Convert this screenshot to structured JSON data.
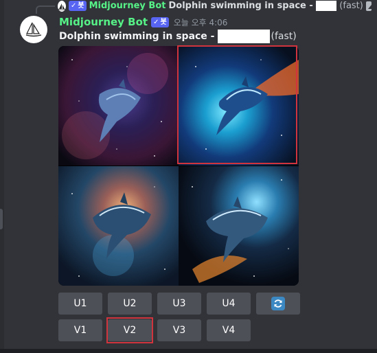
{
  "reply": {
    "bot_name": "Midjourney Bot",
    "bot_badge": "봇",
    "text": "Dolphin swimming in space -",
    "suffix": "(fast)",
    "avatar_icon": "sailboat-logo",
    "image_icon": "image-icon"
  },
  "message": {
    "username": "Midjourney Bot",
    "bot_badge": "봇",
    "timestamp": "오늘 오후 4:06",
    "prompt": "Dolphin swimming in space -",
    "suffix": "(fast)",
    "avatar_icon": "sailboat-logo"
  },
  "images": [
    {
      "label": "image-1",
      "desc": "dolphin"
    },
    {
      "label": "image-2",
      "desc": "dolphin"
    },
    {
      "label": "image-3",
      "desc": "dolphin"
    },
    {
      "label": "image-4",
      "desc": "dolphin"
    }
  ],
  "buttons": {
    "u1": "U1",
    "u2": "U2",
    "u3": "U3",
    "u4": "U4",
    "refresh_icon": "refresh-icon",
    "v1": "V1",
    "v2": "V2",
    "v3": "V3",
    "v4": "V4"
  },
  "colors": {
    "background": "#313338",
    "username": "#57f287",
    "bot_badge": "#5865f2",
    "button": "#4e5058",
    "highlight": "#d1343c"
  }
}
